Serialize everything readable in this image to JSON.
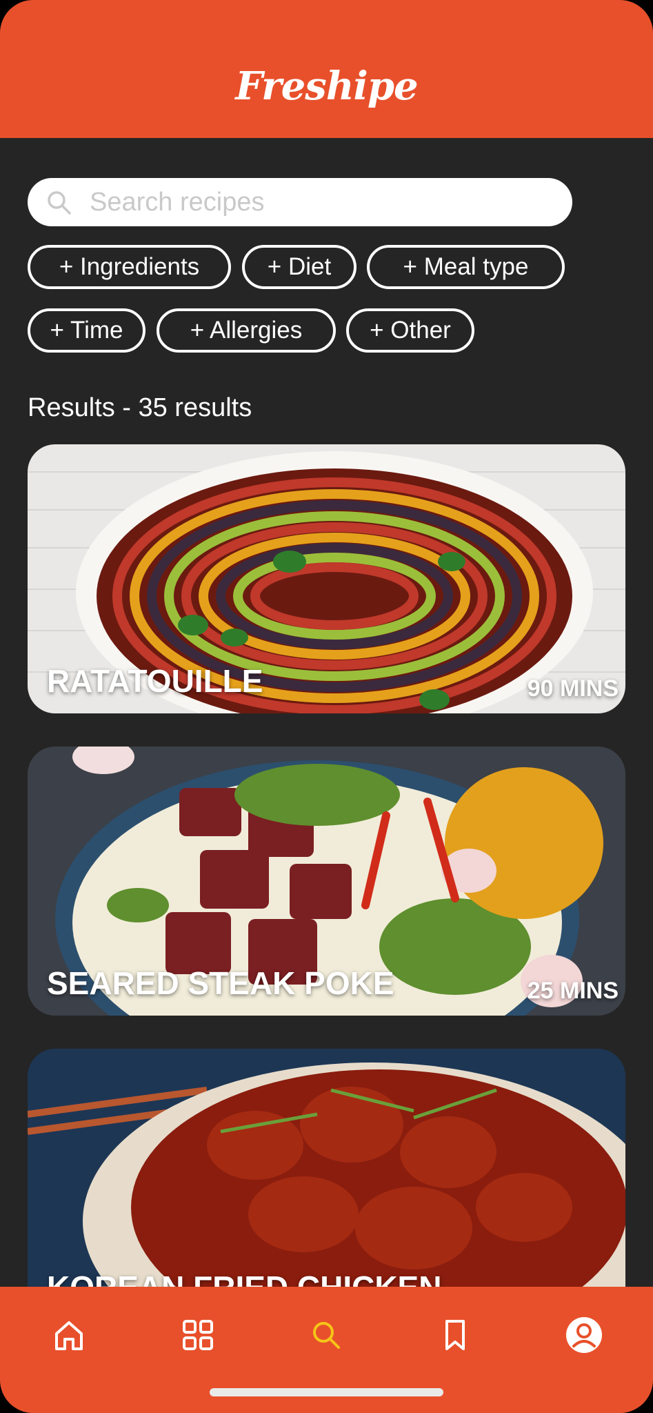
{
  "app": {
    "title": "Freshipe"
  },
  "search": {
    "placeholder": "Search recipes"
  },
  "filters": [
    {
      "label": "+ Ingredients"
    },
    {
      "label": "+ Diet"
    },
    {
      "label": "+ Meal type"
    },
    {
      "label": "+ Time"
    },
    {
      "label": "+ Allergies"
    },
    {
      "label": "+ Other"
    }
  ],
  "results": {
    "heading": "Results - 35 results"
  },
  "recipes": [
    {
      "name": "RATATOUILLE",
      "time": "90 MINS"
    },
    {
      "name": "SEARED STEAK POKE",
      "time": "25 MINS"
    },
    {
      "name": "KOREAN FRIED CHICKEN",
      "time": ""
    }
  ],
  "nav": {
    "items": [
      {
        "icon": "home-icon",
        "active": false
      },
      {
        "icon": "grid-icon",
        "active": false
      },
      {
        "icon": "search-icon",
        "active": true
      },
      {
        "icon": "bookmark-icon",
        "active": false
      },
      {
        "icon": "profile-icon",
        "active": false
      }
    ]
  },
  "colors": {
    "brand": "#E8502B",
    "background": "#252525",
    "active_nav": "#F5C518"
  }
}
